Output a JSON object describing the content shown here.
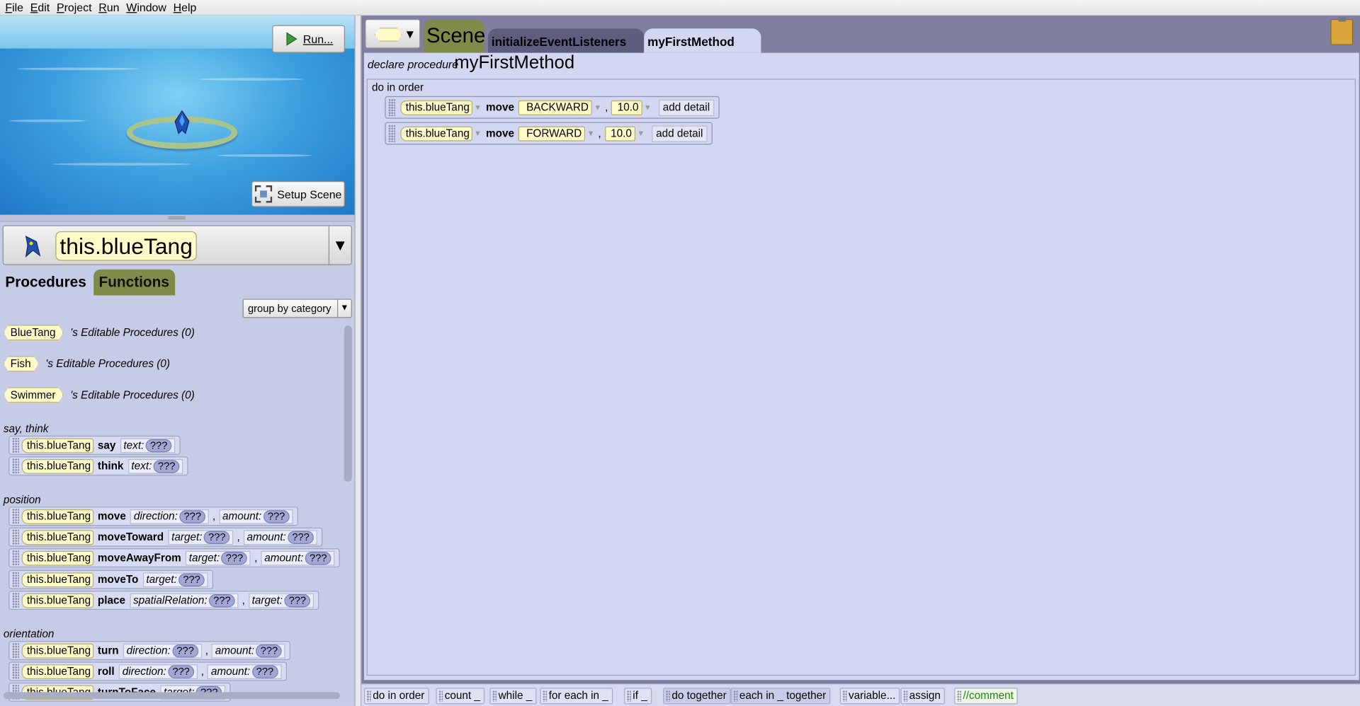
{
  "menu": [
    {
      "first": "F",
      "rest": "ile"
    },
    {
      "first": "E",
      "rest": "dit"
    },
    {
      "first": "P",
      "rest": "roject"
    },
    {
      "first": "R",
      "rest": "un"
    },
    {
      "first": "W",
      "rest": "indow"
    },
    {
      "first": "H",
      "rest": "elp"
    }
  ],
  "scene_view": {
    "run_label": "Run...",
    "setup_label": "Setup Scene"
  },
  "instance_selector": {
    "value": "this.blueTang"
  },
  "left_tabs": {
    "procedures": "Procedures",
    "functions": "Functions"
  },
  "group_select": {
    "value": "group by category"
  },
  "palette": {
    "types": [
      {
        "name": "BlueTang",
        "suffix": "'s Editable Procedures (0)"
      },
      {
        "name": "Fish",
        "suffix": "'s Editable Procedures (0)"
      },
      {
        "name": "Swimmer",
        "suffix": "'s Editable Procedures (0)"
      }
    ],
    "categories": {
      "say_think": "say, think",
      "position": "position",
      "orientation": "orientation"
    },
    "object": "this.blueTang",
    "placeholder": "???",
    "say": {
      "name": "say",
      "p1": "text:"
    },
    "think": {
      "name": "think",
      "p1": "text:"
    },
    "move": {
      "name": "move",
      "p1": "direction:",
      "p2": "amount:"
    },
    "moveToward": {
      "name": "moveToward",
      "p1": "target:",
      "p2": "amount:"
    },
    "moveAwayFrom": {
      "name": "moveAwayFrom",
      "p1": "target:",
      "p2": "amount:"
    },
    "moveTo": {
      "name": "moveTo",
      "p1": "target:"
    },
    "place": {
      "name": "place",
      "p1": "spatialRelation:",
      "p2": "target:"
    },
    "turn": {
      "name": "turn",
      "p1": "direction:",
      "p2": "amount:"
    },
    "roll": {
      "name": "roll",
      "p1": "direction:",
      "p2": "amount:"
    },
    "turnToFace": {
      "name": "turnToFace",
      "p1": "target:"
    }
  },
  "code_tabs": {
    "scene": "Scene",
    "init": "initializeEventListeners",
    "current": "myFirstMethod"
  },
  "editor": {
    "declare_label": "declare procedure",
    "method_name": "myFirstMethod",
    "do_in_order": "do in order",
    "statements": [
      {
        "object": "this.blueTang",
        "method": "move",
        "direction": "BACKWARD",
        "amount": "10.0",
        "detail": "add detail"
      },
      {
        "object": "this.blueTang",
        "method": "move",
        "direction": "FORWARD",
        "amount": "10.0",
        "detail": "add detail"
      }
    ]
  },
  "bottom_bar": {
    "do_in_order": "do in order",
    "count": "count _",
    "while": "while _",
    "for_each_in": "for each in _",
    "if": "if _",
    "do_together": "do together",
    "each_in_together": "each in _ together",
    "variable": "variable...",
    "assign": "assign",
    "comment": "//comment"
  }
}
